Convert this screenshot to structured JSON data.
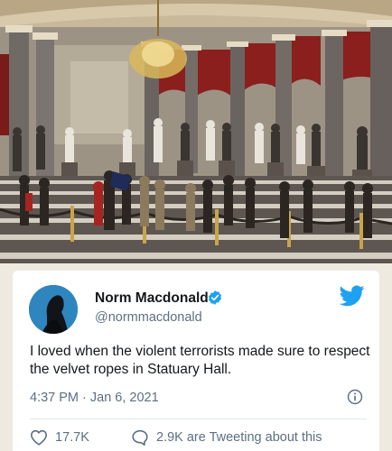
{
  "photo": {
    "alt_icon": "statuary-hall-photo"
  },
  "tweet": {
    "author_name": "Norm Macdonald",
    "author_handle": "@normmacdonald",
    "text": "I loved when the violent terrorists made sure to respect the velvet ropes in Statuary Hall.",
    "time": "4:37 PM · Jan 6, 2021",
    "likes": "17.7K",
    "conversation": "2.9K are Tweeting about this"
  },
  "colors": {
    "twitter_blue": "#1da1f2",
    "secondary_text": "#5b7083"
  }
}
